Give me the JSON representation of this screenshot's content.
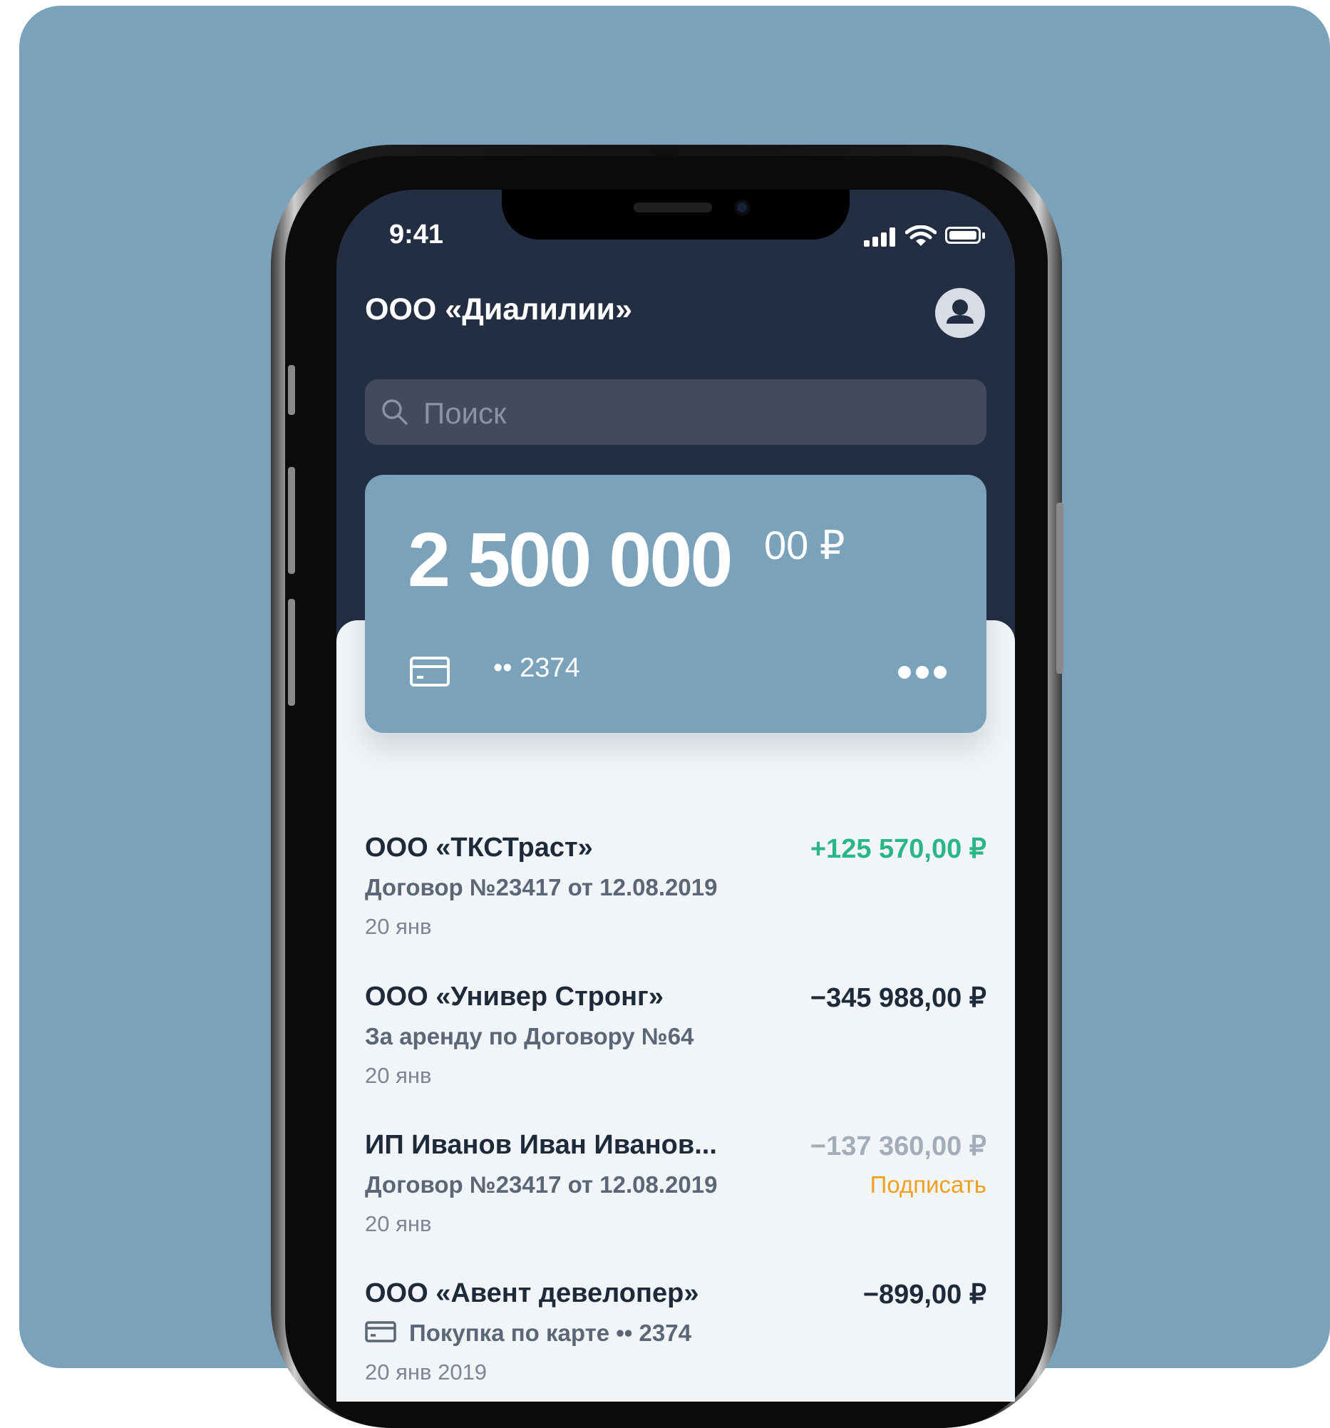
{
  "status_bar": {
    "time": "9:41"
  },
  "header": {
    "company": "ООО «Диалилии»"
  },
  "search": {
    "placeholder": "Поиск"
  },
  "account_card": {
    "balance_integer": "2 500 000",
    "balance_decimal": "00 ₽",
    "card_number": "•• 2374"
  },
  "transactions": [
    {
      "name": "ООО «ТКСТраст»",
      "amount": "+125 570,00 ₽",
      "amount_color": "#2bb68a",
      "description": "Договор №23417 от 12.08.2019",
      "date": "20 янв"
    },
    {
      "name": "ООО «Универ Стронг»",
      "amount": "−345 988,00 ₽",
      "amount_color": "#1d2a3a",
      "description": "За аренду по Договору №64",
      "date": "20 янв"
    },
    {
      "name": "ИП Иванов Иван Иванов...",
      "amount": "−137 360,00 ₽",
      "amount_color": "#a3adb9",
      "description": "Договор №23417 от 12.08.2019",
      "date": "20 янв",
      "action": "Подписать"
    },
    {
      "name": "ООО «Авент девелопер»",
      "amount": "−899,00 ₽",
      "amount_color": "#1d2a3a",
      "description": "Покупка по карте  •• 2374",
      "date": "20 янв 2019"
    }
  ],
  "colors": {
    "background": "#7aa2bb",
    "header_bg": "#232e42",
    "card_bg": "#7aa2bb",
    "positive": "#2bb68a",
    "action": "#f0a020"
  }
}
